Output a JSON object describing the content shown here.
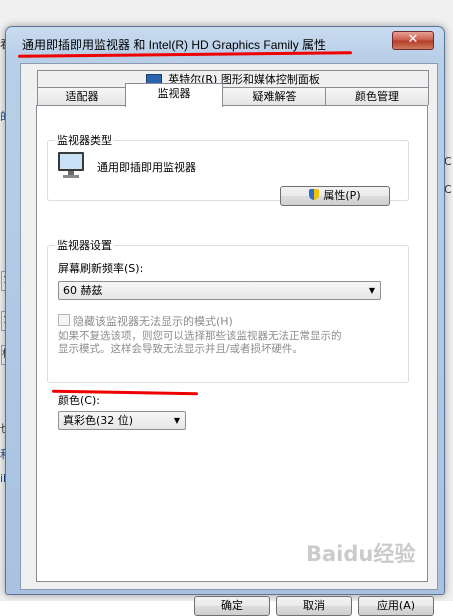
{
  "window": {
    "title": "通用即插即用监视器 和 Intel(R) HD Graphics Family 属性",
    "close_symbol": "✕"
  },
  "tabs": {
    "row1": [
      "英特尔(R) 图形和媒体控制面板"
    ],
    "row2": [
      "适配器",
      "监视器",
      "疑难解答",
      "颜色管理"
    ],
    "active": "监视器"
  },
  "monitor_type": {
    "group_label": "监视器类型",
    "name": "通用即插即用监视器",
    "properties_button": "属性(P)"
  },
  "monitor_settings": {
    "group_label": "监视器设置",
    "refresh_label": "屏幕刷新频率(S):",
    "refresh_value": "60 赫兹",
    "hide_modes_label": "隐藏该监视器无法显示的模式(H)",
    "hide_modes_checked": false,
    "warning_line1": "如果不复选该项，则您可以选择那些该监视器无法正常显示的",
    "warning_line2": "显示模式。这样会导致无法显示并且/或者损坏硬件。"
  },
  "color": {
    "label": "颜色(C):",
    "value": "真彩色(32 位)"
  },
  "footer": {
    "ok": "确定",
    "cancel": "取消",
    "apply": "应用(A)"
  },
  "background": {
    "left_fragments": [
      "看有",
      "的",
      "1",
      "1",
      "标",
      "也",
      "和",
      "ik"
    ],
    "right_fragments": [
      "C",
      "C"
    ]
  },
  "watermark": "Baidu经验",
  "annotation_color": "#e00000"
}
